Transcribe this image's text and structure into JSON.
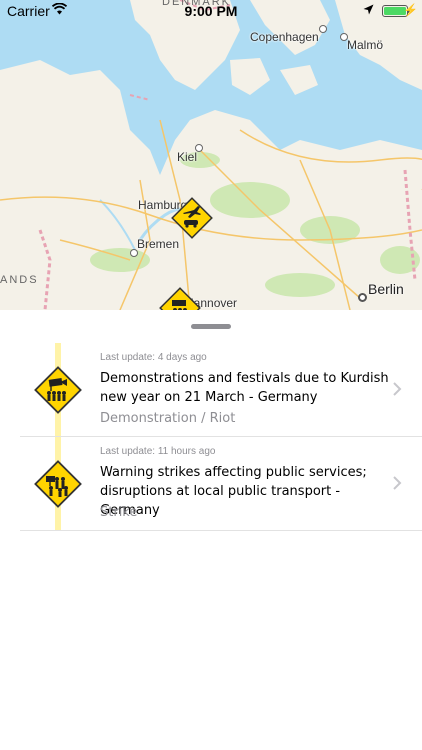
{
  "status_bar": {
    "carrier": "Carrier",
    "time": "9:00 PM"
  },
  "map": {
    "regions": [
      "DENMARK",
      "ANDS"
    ],
    "cities": [
      "Copenhagen",
      "Malmö",
      "Kiel",
      "Hamburg",
      "Bremen",
      "Hannover",
      "Berlin"
    ],
    "pin_icons": [
      "travel-disruption-warning-icon",
      "demonstration-warning-icon"
    ]
  },
  "alerts": [
    {
      "updated": "Last update: 4 days ago",
      "title": "Demonstrations and festivals due to Kurdish new year on 21 March - Germany",
      "category": "Demonstration / Riot",
      "icon": "demonstration-warning-icon"
    },
    {
      "updated": "Last update: 11 hours ago",
      "title": "Warning strikes affecting public services; disruptions at local public transport - Germany",
      "category": "Strike",
      "icon": "strike-warning-icon"
    }
  ],
  "colors": {
    "warning_yellow": "#ffd400",
    "timeline": "#fff3a8",
    "water": "#aedcf3",
    "land": "#f4f1e8",
    "green": "#cfe8b4"
  }
}
